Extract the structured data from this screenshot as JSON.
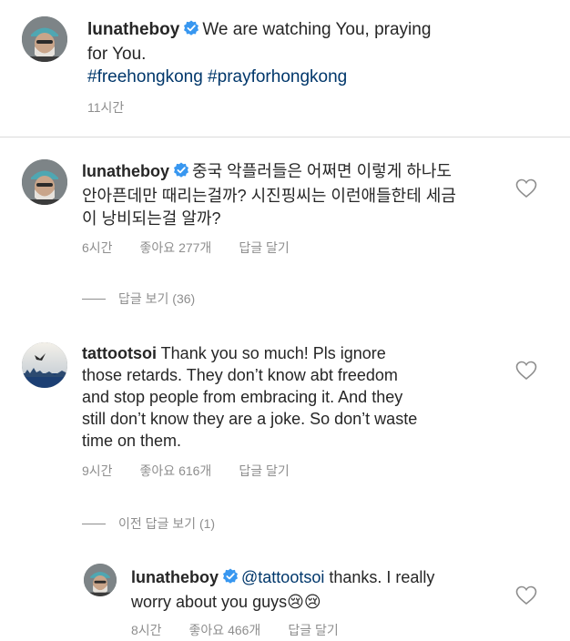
{
  "caption": {
    "username": "lunatheboy",
    "text_line1": "We are watching You, praying",
    "text_line2": "for You.",
    "hashtags": "#freehongkong #prayforhongkong",
    "time": "11시간"
  },
  "comments": [
    {
      "username": "lunatheboy",
      "line1": "중국 악플러들은 어쩌면 이렇게 하나도",
      "line2": "안아픈데만 때리는걸까? 시진핑씨는 이런애들한테 세금",
      "line3": "이 낭비되는걸 알까?",
      "time": "6시간",
      "likes": "좋아요 277개",
      "reply": "답글 달기",
      "view_replies": "답글 보기 (36)"
    },
    {
      "username": "tattootsoi",
      "line1": "Thank you so much! Pls ignore",
      "line2": "those retards. They don’t know abt freedom",
      "line3": "and stop people from embracing it. And they",
      "line4": "still don’t know they are a joke. So don’t waste",
      "line5": "time on them.",
      "time": "9시간",
      "likes": "좋아요 616개",
      "reply": "답글 달기",
      "view_prev_replies": "이전 답글 보기 (1)"
    },
    {
      "username": "lunatheboy",
      "mention": "@tattootsoi",
      "line1_rest": " thanks. I really",
      "line2": "worry about you guys",
      "emoji": "😢😢",
      "time": "8시간",
      "likes": "좋아요 466개",
      "reply": "답글 달기"
    }
  ],
  "colors": {
    "text": "#262626",
    "secondary": "#8e8e8e",
    "verified": "#3897f0",
    "link": "#00376b",
    "divider": "#dbdbdb"
  },
  "icons": [
    "verified-badge-icon",
    "heart-outline-icon"
  ]
}
